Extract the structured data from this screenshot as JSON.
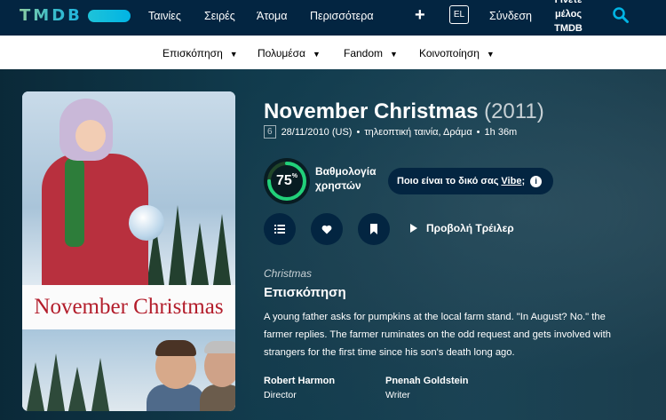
{
  "brand": {
    "logo_text": "TMDB"
  },
  "nav": {
    "items": [
      "Ταινίες",
      "Σειρές",
      "Άτομα",
      "Περισσότερα"
    ],
    "add_symbol": "+",
    "language": "EL",
    "login": "Σύνδεση",
    "join": "Γίνετε μέλος TMDB"
  },
  "subnav": {
    "items": [
      "Επισκόπηση",
      "Πολυμέσα",
      "Fandom",
      "Κοινοποίηση"
    ]
  },
  "movie": {
    "title": "November Christmas",
    "year": "(2011)",
    "certification": "6",
    "release": "28/11/2010 (US)",
    "genres": "τηλεοπτική ταινία, Δράμα",
    "runtime": "1h 36m",
    "poster_title": "November Christmas",
    "user_score": 75,
    "user_score_label": "Βαθμολογία χρηστών",
    "vibe_prompt": "Ποιο είναι το δικό σας",
    "vibe_word": "Vibe",
    "vibe_suffix": ";",
    "trailer_label": "Προβολή Τρέιλερ",
    "tagline": "Christmas",
    "overview_heading": "Επισκόπηση",
    "overview": "A young father asks for pumpkins at the local farm stand. \"In August? No.\" the farmer replies. The farmer ruminates on the odd request and gets involved with strangers for the first time since his son's death long ago.",
    "crew": [
      {
        "name": "Robert Harmon",
        "job": "Director"
      },
      {
        "name": "Pnenah Goldstein",
        "job": "Writer"
      }
    ]
  },
  "colors": {
    "navy": "#032541",
    "accent": "#01b4e4",
    "score_good": "#21d07a",
    "poster_red": "#b31d2b"
  },
  "icons": {
    "list": "list-icon",
    "favorite": "heart-icon",
    "watchlist": "bookmark-icon",
    "play": "play-icon",
    "search": "search-icon"
  }
}
